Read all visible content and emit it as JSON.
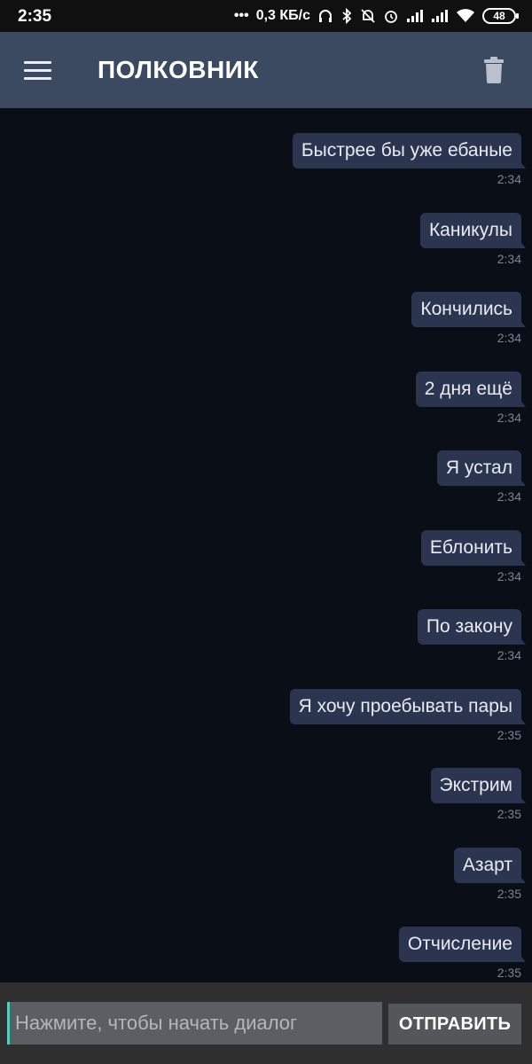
{
  "status_bar": {
    "time": "2:35",
    "dots": "•••",
    "net_speed": "0,3 КБ/с",
    "battery": "48",
    "icons": [
      "headphones-icon",
      "bluetooth-icon",
      "alarm-muted-icon",
      "alarm-clock-icon",
      "signal-icon",
      "signal-icon",
      "wifi-icon",
      "battery-icon"
    ]
  },
  "header": {
    "title": "ПОЛКОВНИК",
    "icons": [
      "menu-icon",
      "trash-icon"
    ]
  },
  "messages": [
    {
      "text": "Быстрее бы уже ебаные",
      "time": "2:34"
    },
    {
      "text": "Каникулы",
      "time": "2:34"
    },
    {
      "text": "Кончились",
      "time": "2:34"
    },
    {
      "text": "2 дня ещё",
      "time": "2:34"
    },
    {
      "text": "Я устал",
      "time": "2:34"
    },
    {
      "text": "Еблонить",
      "time": "2:34"
    },
    {
      "text": "По закону",
      "time": "2:34"
    },
    {
      "text": "Я хочу проебывать пары",
      "time": "2:35"
    },
    {
      "text": "Экстрим",
      "time": "2:35"
    },
    {
      "text": "Азарт",
      "time": "2:35"
    },
    {
      "text": "Отчисление",
      "time": "2:35"
    }
  ],
  "composer": {
    "placeholder": "Нажмите, чтобы начать диалог",
    "value": "",
    "send_label": "ОТПРАВИТЬ"
  },
  "colors": {
    "background": "#090e17",
    "app_bar": "#3b4a60",
    "bubble": "#2c3550",
    "input_bar": "#2f2f2f",
    "cursor_accent": "#4ed1c0"
  }
}
